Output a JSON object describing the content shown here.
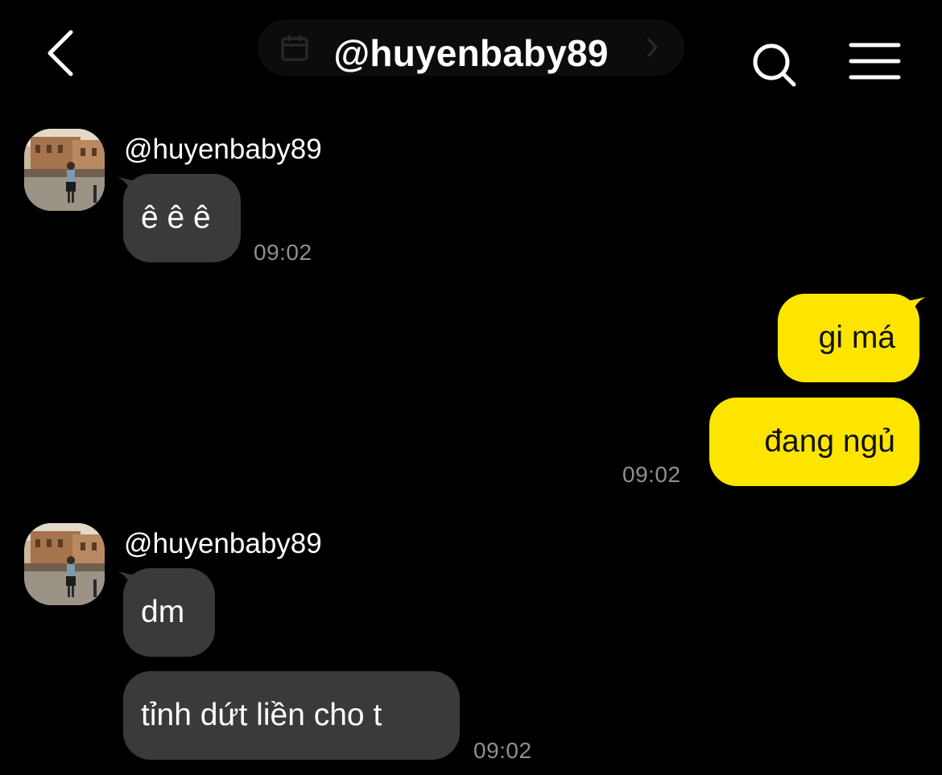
{
  "header": {
    "title": "@huyenbaby89",
    "back_icon": "chevron-left-icon",
    "search_icon": "search-icon",
    "menu_icon": "hamburger-menu-icon",
    "date_icon": "calendar-icon"
  },
  "colors": {
    "background": "#000000",
    "incoming_bubble": "#3a3a3c",
    "outgoing_bubble": "#fde500",
    "timestamp": "#8e8e93"
  },
  "messages": [
    {
      "sender": "@huyenbaby89",
      "text": "ê ê ê",
      "time": "09:02",
      "direction": "incoming"
    },
    {
      "text": "gi má",
      "direction": "outgoing"
    },
    {
      "text": "đang ngủ",
      "time": "09:02",
      "direction": "outgoing"
    },
    {
      "sender": "@huyenbaby89",
      "text": "dm",
      "direction": "incoming"
    },
    {
      "text": "tỉnh dứt liền cho t",
      "time": "09:02",
      "direction": "incoming"
    }
  ]
}
